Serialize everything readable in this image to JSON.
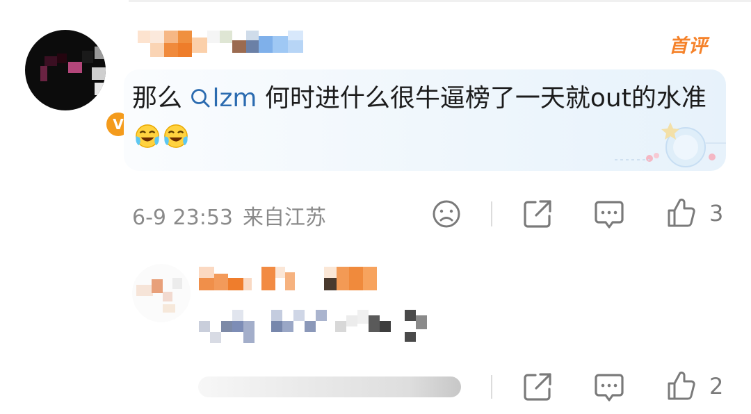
{
  "comment": {
    "first_badge": "首评",
    "text_prefix": "那么 ",
    "mention_name": "lzm",
    "text_suffix": " 何时进什么很牛逼榜了一天就out的水准",
    "emoji_name": "crying-laughing-face",
    "timestamp": "6-9 23:53",
    "location": "来自江苏",
    "like_count": "3",
    "verified_badge": "V",
    "mention_icon": "search-icon"
  },
  "reply": {
    "like_count": "2"
  },
  "icons": {
    "dislike": "sad-face-icon",
    "share": "share-icon",
    "reply": "comment-bubble-icon",
    "like": "thumbs-up-icon"
  },
  "colors": {
    "accent_orange": "#f5822a",
    "mention_blue": "#2b6bb0",
    "icon_gray": "#7a7a7a",
    "meta_gray": "#8a8a8a",
    "verified_orange": "#f49b1c"
  }
}
